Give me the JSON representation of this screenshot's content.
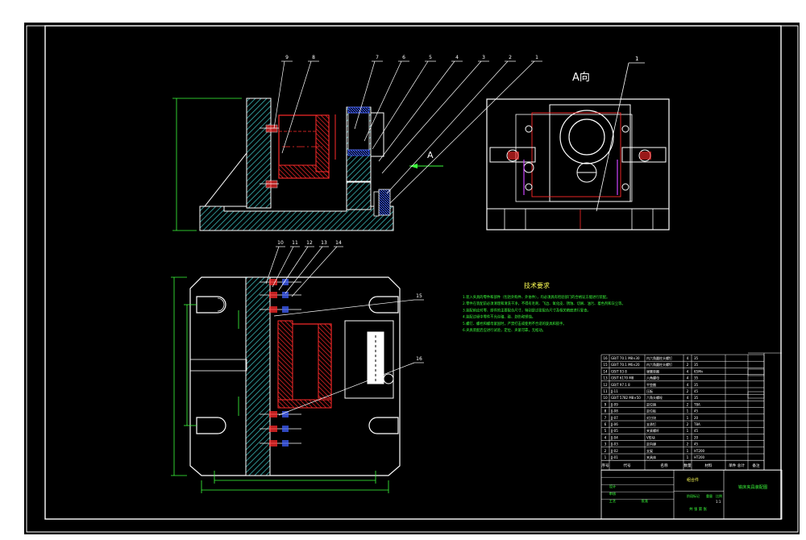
{
  "views": {
    "a_view_label": "A向",
    "a_arrow_letter": "A"
  },
  "balloons": {
    "top": [
      "9",
      "8",
      "7",
      "6",
      "5",
      "4",
      "3",
      "2",
      "1"
    ],
    "plan": [
      "10",
      "11",
      "12",
      "13",
      "14"
    ],
    "plan_right": [
      "15",
      "16"
    ]
  },
  "tech_req": {
    "title": "技术要求",
    "lines": [
      "1.装入夹具的零件和部件（包括外购件、外协件），均必须具有检验部门的合格证方能进行装配。",
      "2.零件在装配前必须清理和清洗干净，不得有毛刺、飞边、氧化皮、锈蚀、切屑、油污、着色剂和灰尘等。",
      "3.装配前应对零、部件的主要配合尺寸，特别是过盈配合尺寸及相关精度进行复查。",
      "4.装配过程中零件不允许磕、碰、划伤和锈蚀。",
      "5.螺钉、螺栓和螺母紧固时，严禁打击或使用不合适的旋具和扳手。",
      "6.夹具装配后应进行试验，定位、夹紧可靠，无松动。"
    ]
  },
  "title_block": {
    "part_name": "铣床夹具装配图",
    "material_cell": "组合件",
    "header_seq": "序号",
    "header_code": "代号",
    "header_name": "名称",
    "header_qty": "数量",
    "header_material": "材料",
    "header_weight": "单件 总计",
    "header_note": "备注",
    "label_design": "设计",
    "label_check": "审核",
    "label_process": "工艺",
    "label_approve": "批准",
    "label_stage": "阶段标记",
    "label_weight": "重量",
    "label_scale": "比例",
    "scale_value": "1:1",
    "label_sheet": "共 张 第 张"
  },
  "parts_list": [
    {
      "seq": "16",
      "code": "GB/T 70.1 M8×30",
      "name": "内六角圆柱头螺钉",
      "qty": "4",
      "material": "35"
    },
    {
      "seq": "15",
      "code": "GB/T 70.1 M6×20",
      "name": "内六角圆柱头螺钉",
      "qty": "2",
      "material": "35"
    },
    {
      "seq": "14",
      "code": "GB/T 93 8",
      "name": "弹簧垫圈",
      "qty": "4",
      "material": "65Mn"
    },
    {
      "seq": "13",
      "code": "GB/T 6170 M8",
      "name": "六角螺母",
      "qty": "4",
      "material": "35"
    },
    {
      "seq": "12",
      "code": "GB/T 97.1 8",
      "name": "平垫圈",
      "qty": "4",
      "material": "35"
    },
    {
      "seq": "11",
      "code": "JJ-11",
      "name": "压板",
      "qty": "2",
      "material": "45"
    },
    {
      "seq": "10",
      "code": "GB/T 5782 M8×50",
      "name": "六角头螺栓",
      "qty": "4",
      "material": "35"
    },
    {
      "seq": "9",
      "code": "JJ-09",
      "name": "定位销",
      "qty": "2",
      "material": "T8A"
    },
    {
      "seq": "8",
      "code": "JJ-08",
      "name": "定位板",
      "qty": "1",
      "material": "45"
    },
    {
      "seq": "7",
      "code": "JJ-07",
      "name": "对刀块",
      "qty": "1",
      "material": "20"
    },
    {
      "seq": "6",
      "code": "JJ-06",
      "name": "支承钉",
      "qty": "2",
      "material": "T8A"
    },
    {
      "seq": "5",
      "code": "JJ-05",
      "name": "夹紧螺杆",
      "qty": "1",
      "material": "45"
    },
    {
      "seq": "4",
      "code": "JJ-04",
      "name": "V形块",
      "qty": "1",
      "material": "20"
    },
    {
      "seq": "3",
      "code": "JJ-03",
      "name": "定向键",
      "qty": "2",
      "material": "45"
    },
    {
      "seq": "2",
      "code": "JJ-02",
      "name": "支架",
      "qty": "1",
      "material": "HT200"
    },
    {
      "seq": "1",
      "code": "JJ-01",
      "name": "夹具体",
      "qty": "1",
      "material": "HT200"
    }
  ]
}
